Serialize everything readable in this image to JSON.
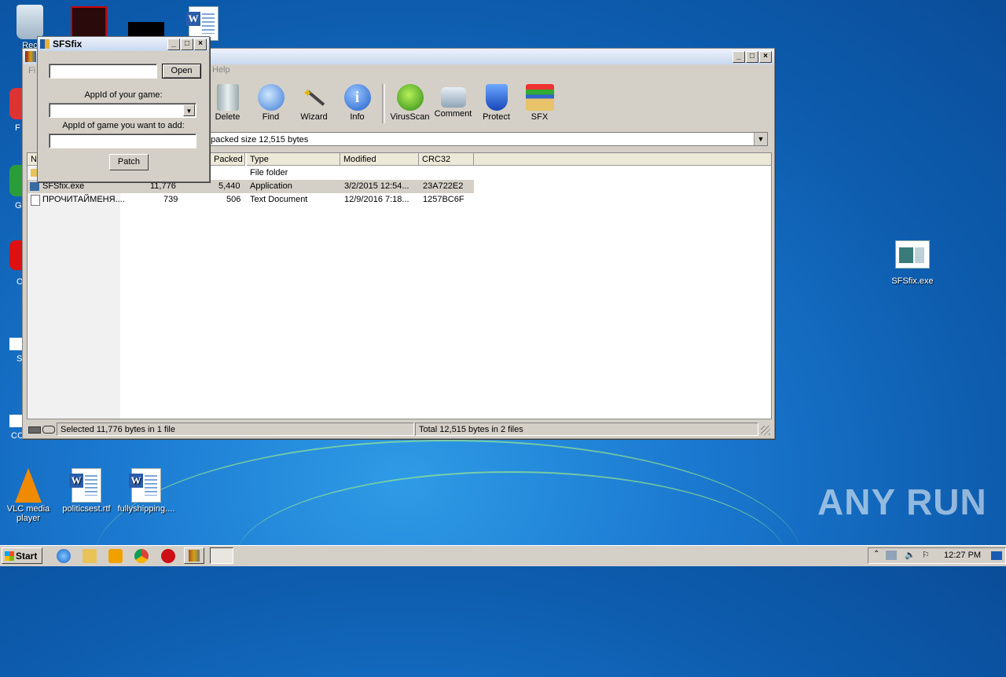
{
  "desktop": {
    "icons": [
      {
        "label": "Rec"
      },
      {
        "label": "SFSfix.exe"
      },
      {
        "label": "VLC media player"
      },
      {
        "label": "politicsest.rtf"
      },
      {
        "label": "fullyshipping...."
      }
    ],
    "side_labels": [
      "F",
      "G",
      "O",
      "S",
      "CC"
    ]
  },
  "winrar": {
    "menu_visible": "Help",
    "menu_partial": "Fi",
    "toolbar": [
      {
        "label": "Delete",
        "icon": "trash-icon"
      },
      {
        "label": "Find",
        "icon": "magnifier-icon"
      },
      {
        "label": "Wizard",
        "icon": "wand-icon"
      },
      {
        "label": "Info",
        "icon": "info-icon"
      },
      {
        "label": "VirusScan",
        "icon": "virus-icon"
      },
      {
        "label": "Comment",
        "icon": "comment-icon"
      },
      {
        "label": "Protect",
        "icon": "shield-icon"
      },
      {
        "label": "SFX",
        "icon": "sfx-box-icon"
      }
    ],
    "address": "npacked size 12,515 bytes",
    "columns": [
      "N",
      "Packed",
      "Type",
      "Modified",
      "CRC32"
    ],
    "rows": [
      {
        "name": "",
        "size": "",
        "packed": "",
        "type": "File folder",
        "modified": "",
        "crc": ""
      },
      {
        "name": "SFSfix.exe",
        "size": "11,776",
        "packed": "5,440",
        "type": "Application",
        "modified": "3/2/2015 12:54...",
        "crc": "23A722E2"
      },
      {
        "name": "ПРОЧИТАЙМЕНЯ....",
        "size": "739",
        "packed": "506",
        "type": "Text Document",
        "modified": "12/9/2016 7:18...",
        "crc": "1257BC6F"
      }
    ],
    "status_left": "Selected 11,776 bytes in 1 file",
    "status_right": "Total 12,515 bytes in 2 files"
  },
  "sfsfix": {
    "title": "SFSfix",
    "open_label": "Open",
    "appid_label": "AppId of your game:",
    "appid_add_label": "AppId of game you want to add:",
    "patch_label": "Patch",
    "path_value": "",
    "appid_value": "",
    "appid_add_value": ""
  },
  "taskbar": {
    "start_label": "Start",
    "clock": "12:27 PM"
  },
  "watermark": "ANY RUN",
  "colors": {
    "selection": "#d4d0c8",
    "desktop": "#1a78cf"
  }
}
